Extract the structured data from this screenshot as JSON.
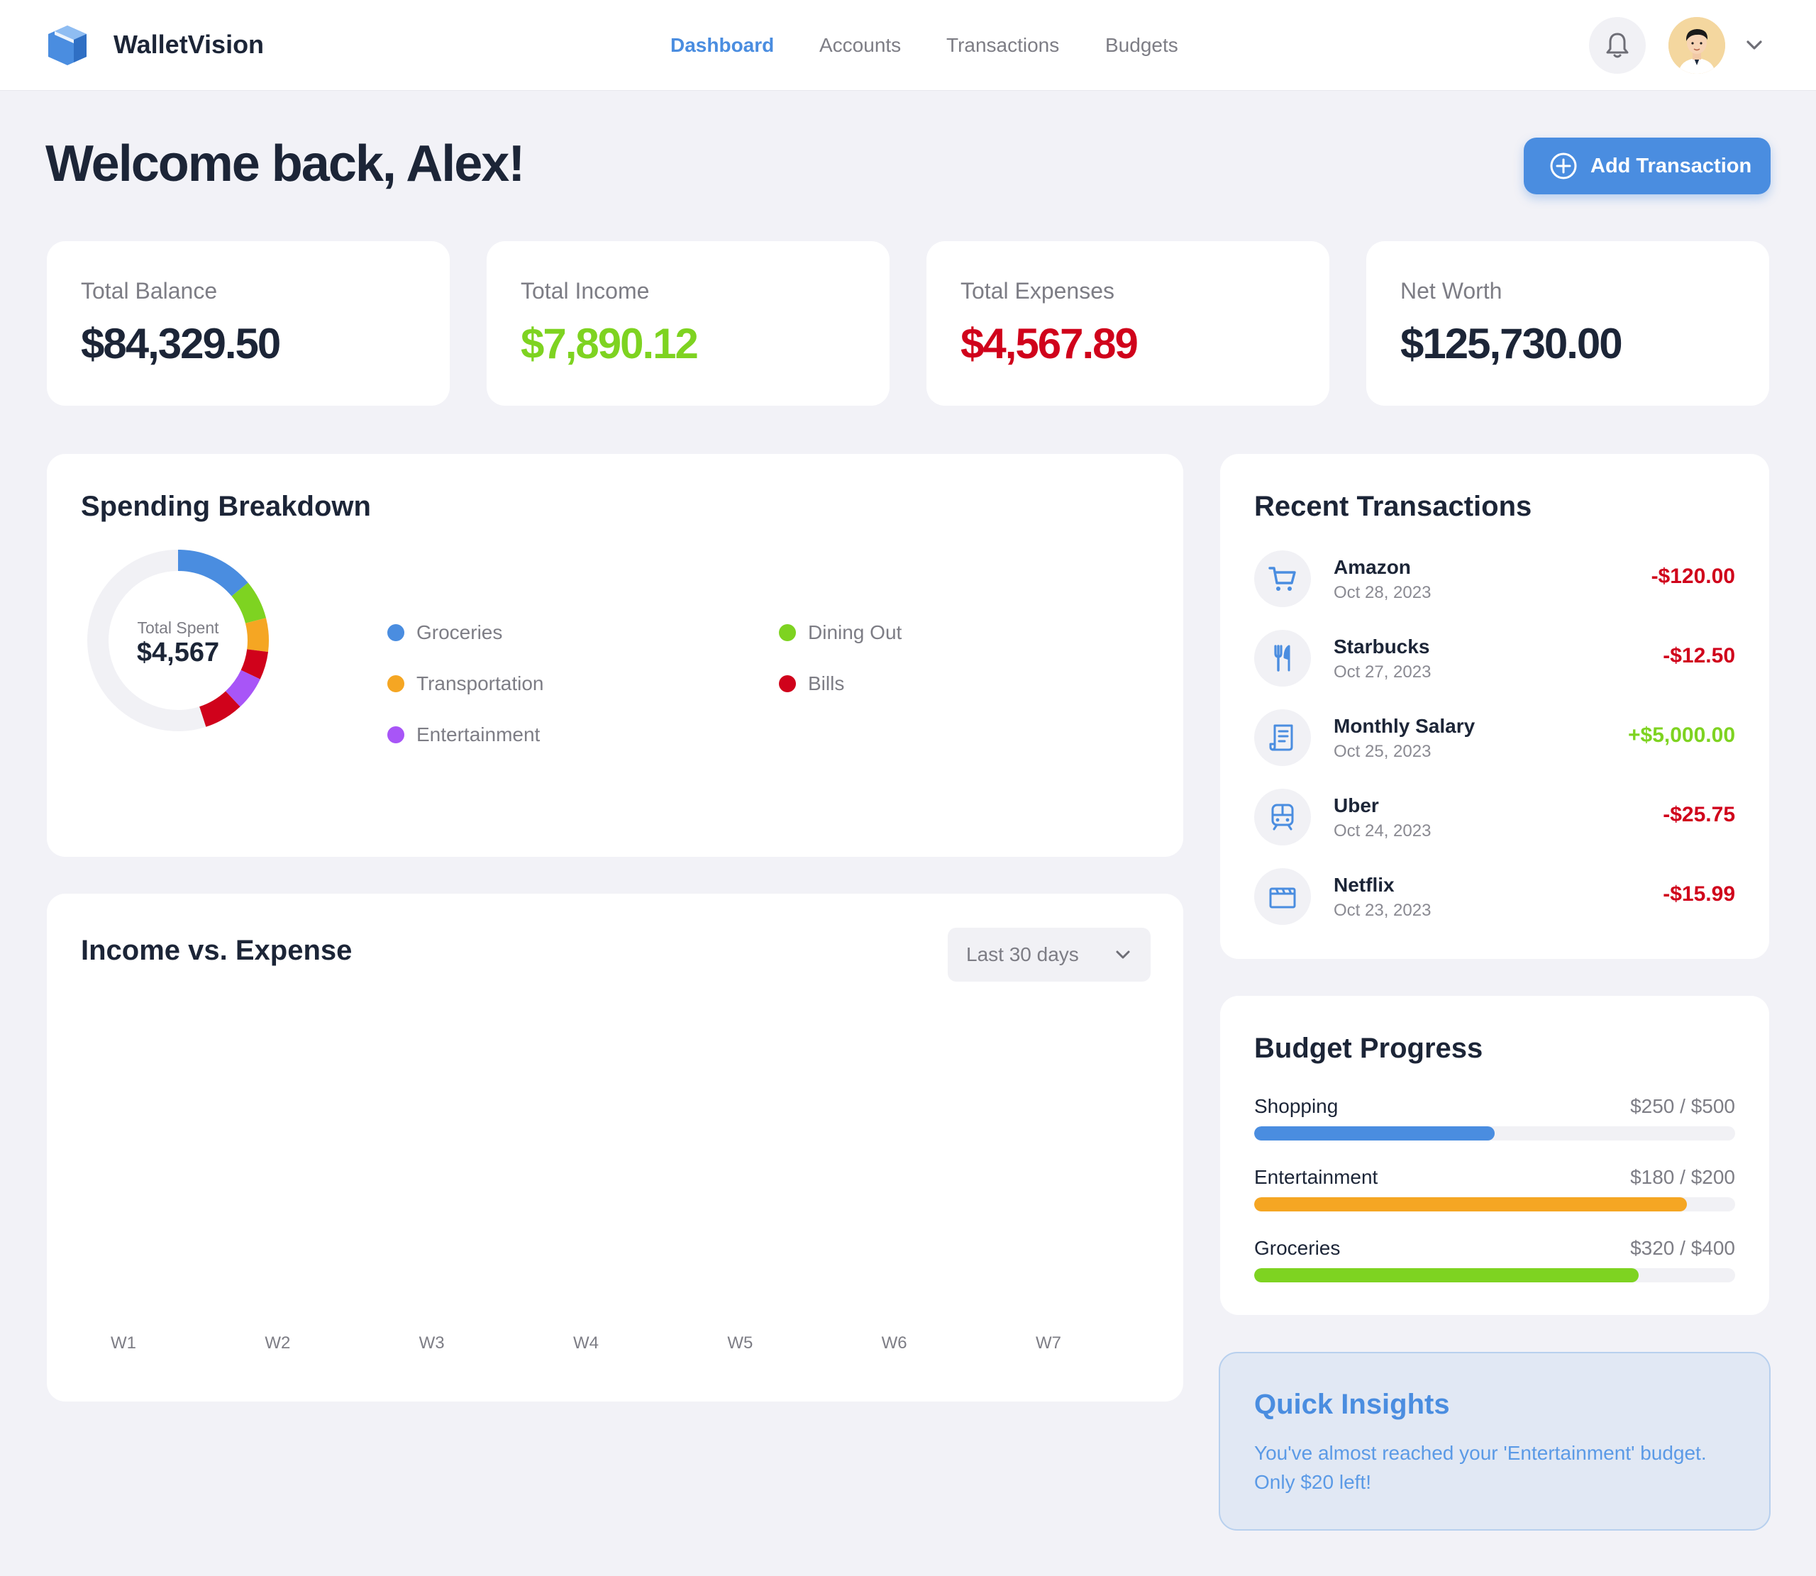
{
  "app": {
    "brand": "WalletVision"
  },
  "nav": {
    "items": [
      "Dashboard",
      "Accounts",
      "Transactions",
      "Budgets"
    ],
    "active": "Dashboard"
  },
  "header": {
    "welcome": "Welcome back, Alex!",
    "add_button": "Add Transaction"
  },
  "stats": [
    {
      "label": "Total Balance",
      "value": "$84,329.50",
      "color": "#1c2537"
    },
    {
      "label": "Total Income",
      "value": "$7,890.12",
      "color": "#7ed321"
    },
    {
      "label": "Total Expenses",
      "value": "$4,567.89",
      "color": "#d0021b"
    },
    {
      "label": "Net Worth",
      "value": "$125,730.00",
      "color": "#1c2537"
    }
  ],
  "spending": {
    "title": "Spending Breakdown",
    "center_label": "Total Spent",
    "center_value": "$4,567"
  },
  "income_expense": {
    "title": "Income vs. Expense",
    "range": "Last 30 days"
  },
  "transactions": {
    "title": "Recent Transactions",
    "items": [
      {
        "name": "Amazon",
        "date": "Oct 28, 2023",
        "amount": "-$120.00",
        "type": "expense",
        "icon": "cart-icon"
      },
      {
        "name": "Starbucks",
        "date": "Oct 27, 2023",
        "amount": "-$12.50",
        "type": "expense",
        "icon": "fork-knife-icon"
      },
      {
        "name": "Monthly Salary",
        "date": "Oct 25, 2023",
        "amount": "+$5,000.00",
        "type": "income",
        "icon": "receipt-icon"
      },
      {
        "name": "Uber",
        "date": "Oct 24, 2023",
        "amount": "-$25.75",
        "type": "expense",
        "icon": "train-icon"
      },
      {
        "name": "Netflix",
        "date": "Oct 23, 2023",
        "amount": "-$15.99",
        "type": "expense",
        "icon": "clapperboard-icon"
      }
    ]
  },
  "budget": {
    "title": "Budget Progress",
    "items": [
      {
        "label": "Shopping",
        "value": "$250 / $500",
        "progress": 0.5,
        "color": "#4a8de0"
      },
      {
        "label": "Entertainment",
        "value": "$180 / $200",
        "progress": 0.9,
        "color": "#f5a623"
      },
      {
        "label": "Groceries",
        "value": "$320 / $400",
        "progress": 0.8,
        "color": "#7ed321"
      }
    ]
  },
  "insights": {
    "title": "Quick Insights",
    "text": "You've almost reached your 'Entertainment' budget. Only $20 left!"
  },
  "colors": {
    "accent": "#4a8de0",
    "income": "#7ed321",
    "expense": "#d0021b"
  },
  "chart_data": [
    {
      "type": "pie",
      "categories": [
        "Groceries",
        "Dining Out",
        "Transportation",
        "Bills",
        "Entertainment"
      ],
      "series": [
        {
          "values": [
            14,
            7,
            6,
            5,
            6,
            7
          ]
        }
      ],
      "segment_categories": [
        "Groceries",
        "Dining Out",
        "Transportation",
        "Bills",
        "Entertainment",
        "Bills"
      ],
      "colors": [
        "#4a8de0",
        "#7ed321",
        "#f5a623",
        "#d0021b",
        "#a855f7",
        "#d0021b"
      ],
      "total_percent_shown": 45,
      "center_label": "Total Spent",
      "center_value": "$4,567",
      "title": "Spending Breakdown"
    },
    {
      "type": "bar",
      "title": "Income vs. Expense",
      "categories": [
        "W1",
        "W2",
        "W3",
        "W4",
        "W5",
        "W6",
        "W7"
      ],
      "series": []
    }
  ]
}
